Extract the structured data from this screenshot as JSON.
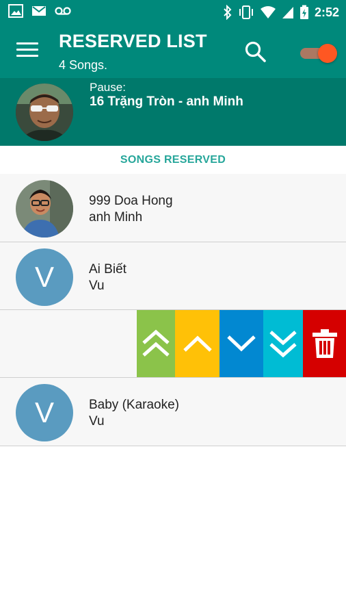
{
  "status_bar": {
    "time": "2:52",
    "left_icons": [
      "image-icon",
      "email-icon",
      "voicemail-icon"
    ],
    "right_icons": [
      "bluetooth-icon",
      "vibrate-icon",
      "wifi-icon",
      "signal-icon",
      "battery-charging-icon"
    ]
  },
  "app_bar": {
    "title": "RESERVED LIST",
    "subtitle": "4 Songs.",
    "menu_icon": "menu-icon",
    "search_icon": "search-icon",
    "toggle_on": true,
    "color": "#00897b"
  },
  "now_playing": {
    "label": "Pause:",
    "song": "16 Trặng Tròn - anh Minh",
    "color": "#00796b"
  },
  "section": {
    "header": "SONGS RESERVED"
  },
  "songs": [
    {
      "title": "999 Doa Hong",
      "artist": "anh Minh",
      "avatar": "photo"
    },
    {
      "title": "Ai Biết",
      "artist": "Vu",
      "avatar": "V"
    },
    {
      "title": "",
      "artist": "",
      "avatar": "",
      "swiped": true
    },
    {
      "title": "Baby (Karaoke)",
      "artist": "Vu",
      "avatar": "V"
    }
  ],
  "swipe_actions": [
    {
      "name": "move-to-top",
      "icon": "double-chevron-up-icon",
      "color": "#8bc34a"
    },
    {
      "name": "move-up",
      "icon": "chevron-up-icon",
      "color": "#ffc107"
    },
    {
      "name": "move-down",
      "icon": "chevron-down-icon",
      "color": "#0288d1"
    },
    {
      "name": "move-to-bottom",
      "icon": "double-chevron-down-icon",
      "color": "#00bcd4"
    },
    {
      "name": "delete",
      "icon": "trash-icon",
      "color": "#d50000"
    }
  ]
}
